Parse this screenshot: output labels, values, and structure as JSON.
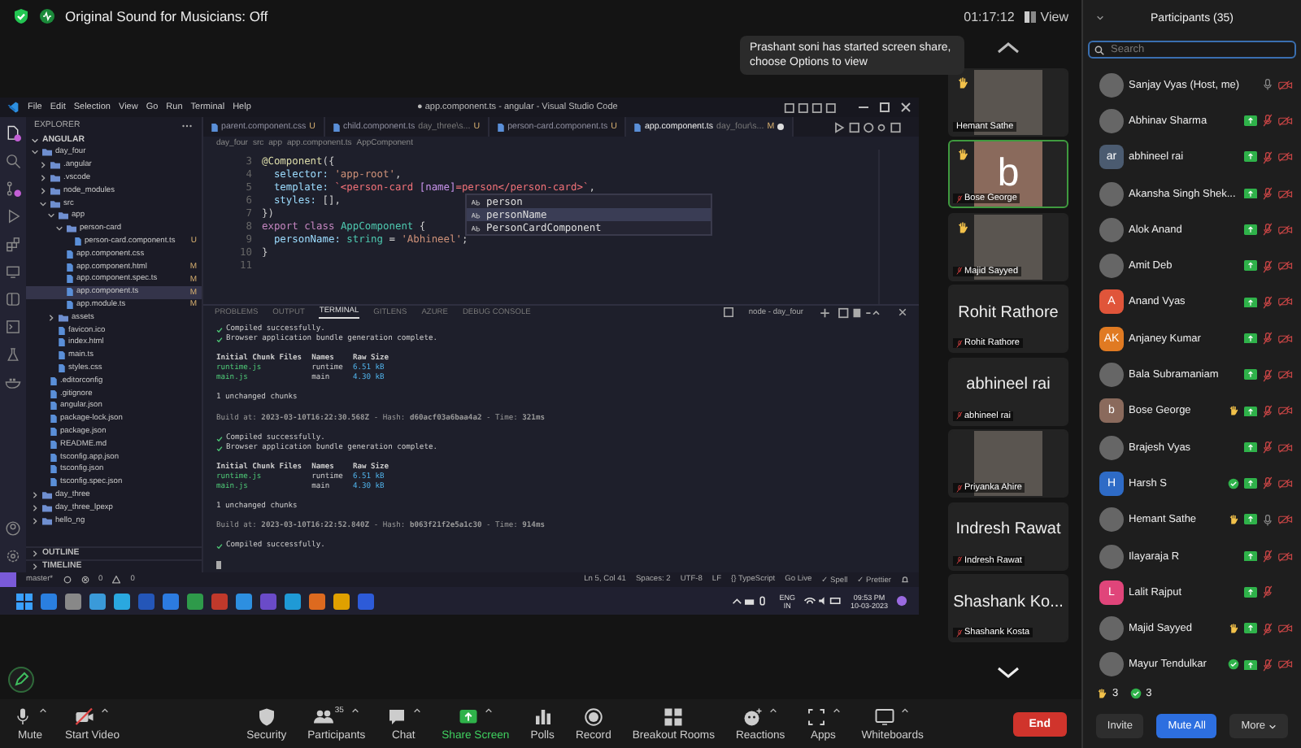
{
  "top_bar": {
    "audio_status": "Original Sound for Musicians: Off",
    "meeting_timer": "01:17:12",
    "view_button": "View"
  },
  "notification": "Prashant soni has started screen share, choose Options to view",
  "shared_screen": {
    "title": "● app.component.ts - angular - Visual Studio Code",
    "menu": [
      "File",
      "Edit",
      "Selection",
      "View",
      "Go",
      "Run",
      "Terminal",
      "Help"
    ],
    "explorer": {
      "title": "EXPLORER",
      "root": "ANGULAR",
      "tree": [
        {
          "label": "day_four",
          "kind": "folder",
          "expanded": true,
          "selected": false,
          "children": [
            {
              "label": ".angular",
              "kind": "folder",
              "expanded": false,
              "selected": false
            },
            {
              "label": ".vscode",
              "kind": "folder",
              "expanded": false,
              "selected": false
            },
            {
              "label": "node_modules",
              "kind": "folder",
              "expanded": false,
              "selected": false
            },
            {
              "label": "src",
              "kind": "folder",
              "expanded": true,
              "selected": false,
              "children": [
                {
                  "label": "app",
                  "kind": "folder",
                  "expanded": true,
                  "selected": false,
                  "children": [
                    {
                      "label": "person-card",
                      "kind": "folder",
                      "expanded": true,
                      "selected": false,
                      "children": [
                        {
                          "label": "person-card.component.ts",
                          "kind": "file",
                          "selected": false,
                          "badge": "U"
                        }
                      ]
                    },
                    {
                      "label": "app.component.css",
                      "kind": "file",
                      "selected": false
                    },
                    {
                      "label": "app.component.html",
                      "kind": "file",
                      "selected": false,
                      "badge": "M"
                    },
                    {
                      "label": "app.component.spec.ts",
                      "kind": "file",
                      "selected": false,
                      "badge": "M"
                    },
                    {
                      "label": "app.component.ts",
                      "kind": "file",
                      "selected": true,
                      "badge": "M"
                    },
                    {
                      "label": "app.module.ts",
                      "kind": "file",
                      "selected": false,
                      "badge": "M"
                    }
                  ]
                },
                {
                  "label": "assets",
                  "kind": "folder",
                  "expanded": false,
                  "selected": false
                },
                {
                  "label": "favicon.ico",
                  "kind": "file",
                  "selected": false
                },
                {
                  "label": "index.html",
                  "kind": "file",
                  "selected": false
                },
                {
                  "label": "main.ts",
                  "kind": "file",
                  "selected": false
                },
                {
                  "label": "styles.css",
                  "kind": "file",
                  "selected": false
                }
              ]
            },
            {
              "label": ".editorconfig",
              "kind": "file",
              "selected": false
            },
            {
              "label": ".gitignore",
              "kind": "file",
              "selected": false
            },
            {
              "label": "angular.json",
              "kind": "file",
              "selected": false
            },
            {
              "label": "package-lock.json",
              "kind": "file",
              "selected": false
            },
            {
              "label": "package.json",
              "kind": "file",
              "selected": false
            },
            {
              "label": "README.md",
              "kind": "file",
              "selected": false
            },
            {
              "label": "tsconfig.app.json",
              "kind": "file",
              "selected": false
            },
            {
              "label": "tsconfig.json",
              "kind": "file",
              "selected": false
            },
            {
              "label": "tsconfig.spec.json",
              "kind": "file",
              "selected": false
            }
          ]
        },
        {
          "label": "day_three",
          "kind": "folder",
          "expanded": false,
          "selected": false
        },
        {
          "label": "day_three_lpexp",
          "kind": "folder",
          "expanded": false,
          "selected": false
        },
        {
          "label": "hello_ng",
          "kind": "folder",
          "expanded": false,
          "selected": false
        }
      ],
      "sections": [
        "OUTLINE",
        "TIMELINE"
      ]
    },
    "tabs": [
      {
        "label": "parent.component.css",
        "badge": "U",
        "selected": false,
        "dirty": false
      },
      {
        "label": "child.component.ts",
        "detail": "day_three\\s...",
        "badge": "U",
        "selected": false,
        "dirty": false
      },
      {
        "label": "person-card.component.ts",
        "badge": "U",
        "selected": false,
        "dirty": false
      },
      {
        "label": "app.component.ts",
        "detail": "day_four\\s...",
        "badge": "M",
        "selected": true,
        "dirty": true
      }
    ],
    "breadcrumb": [
      "day_four",
      "src",
      "app",
      "app.component.ts",
      "AppComponent"
    ],
    "code": [
      {
        "number": "3",
        "segments": [
          {
            "t": "@Component",
            "color": "#dcdcaa"
          },
          {
            "t": "({"
          }
        ]
      },
      {
        "number": "4",
        "segments": [
          {
            "t": "  selector: ",
            "color": "#9cdcfe"
          },
          {
            "t": "'app-root'",
            "color": "#ce9178"
          },
          {
            "t": ","
          }
        ]
      },
      {
        "number": "5",
        "segments": [
          {
            "t": "  template: ",
            "color": "#9cdcfe"
          },
          {
            "t": "`<person-card",
            "color": "#f07178"
          },
          {
            "t": " [name]",
            "color": "#c792ea"
          },
          {
            "t": "=person",
            "color": "#f07178"
          },
          {
            "t": "</person-card>`",
            "color": "#f07178"
          },
          {
            "t": ","
          }
        ]
      },
      {
        "number": "6",
        "segments": [
          {
            "t": "  styles: ",
            "color": "#9cdcfe"
          },
          {
            "t": "[],"
          }
        ]
      },
      {
        "number": "7",
        "segments": [
          {
            "t": "})"
          }
        ]
      },
      {
        "number": "8",
        "segments": [
          {
            "t": "export class ",
            "color": "#c586c0"
          },
          {
            "t": "AppComponent",
            "color": "#4ec9b0"
          },
          {
            "t": " {"
          }
        ]
      },
      {
        "number": "9",
        "segments": [
          {
            "t": "  personName: ",
            "color": "#9cdcfe"
          },
          {
            "t": "string",
            "color": "#4ec9b0"
          },
          {
            "t": " = "
          },
          {
            "t": "'Abhineel'",
            "color": "#ce9178"
          },
          {
            "t": ";"
          }
        ]
      },
      {
        "number": "10",
        "segments": [
          {
            "t": "}"
          }
        ]
      },
      {
        "number": "11"
      }
    ],
    "suggestions": [
      {
        "label": "person",
        "selected": false
      },
      {
        "label": "personName",
        "selected": true
      },
      {
        "label": "PersonCardComponent",
        "selected": false
      }
    ],
    "panel_tabs": [
      {
        "label": "PROBLEMS",
        "selected": false
      },
      {
        "label": "OUTPUT",
        "selected": false
      },
      {
        "label": "TERMINAL",
        "selected": true
      },
      {
        "label": "GITLENS",
        "selected": false
      },
      {
        "label": "AZURE",
        "selected": false
      },
      {
        "label": "DEBUG CONSOLE",
        "selected": false
      }
    ],
    "terminal_name": "node - day_four",
    "terminal": [
      {
        "kind": "success",
        "lines": [
          "Compiled successfully.",
          "Browser application bundle generation complete."
        ]
      },
      {
        "kind": "table",
        "header": [
          "Initial Chunk Files",
          "Names",
          "Raw Size"
        ],
        "rows": [
          [
            "runtime.js",
            "runtime",
            "6.51 kB"
          ],
          [
            "main.js",
            "main",
            "4.30 kB"
          ]
        ]
      },
      {
        "kind": "plain",
        "lines": [
          "1 unchanged chunks"
        ]
      },
      {
        "kind": "build",
        "lines": [
          "Build at: **2023-03-10T16:22:30.568Z** - Hash: **d60acf03a6baa4a2** - Time: **321ms**"
        ]
      },
      {
        "kind": "success",
        "lines": [
          "Compiled successfully.",
          "Browser application bundle generation complete."
        ]
      },
      {
        "kind": "table",
        "header": [
          "Initial Chunk Files",
          "Names",
          "Raw Size"
        ],
        "rows": [
          [
            "runtime.js",
            "runtime",
            "6.51 kB"
          ],
          [
            "main.js",
            "main",
            "4.30 kB"
          ]
        ]
      },
      {
        "kind": "plain",
        "lines": [
          "1 unchanged chunks"
        ]
      },
      {
        "kind": "build",
        "lines": [
          "Build at: **2023-03-10T16:22:52.840Z** - Hash: **b063f21f2e5a1c30** - Time: **914ms**"
        ]
      },
      {
        "kind": "success",
        "lines": [
          "Compiled successfully."
        ]
      }
    ],
    "status_bar": {
      "branch": "master*",
      "errors": "0",
      "warnings": "0",
      "items": [
        "Ln 5, Col 41",
        "Spaces: 2",
        "UTF-8",
        "LF",
        "{} TypeScript",
        "Go Live",
        "✓ Spell",
        "✓ Prettier"
      ]
    },
    "taskbar": {
      "language": "ENG",
      "region": "IN",
      "time": "09:53 PM",
      "date": "10-03-2023"
    }
  },
  "gallery": [
    {
      "name": "Hemant Sathe",
      "kind": "video",
      "hand": true,
      "muted": false,
      "active": false
    },
    {
      "name": "Bose George",
      "kind": "avatar",
      "initial": "b",
      "color": "#8a6a5c",
      "hand": true,
      "muted": true,
      "active": true
    },
    {
      "name": "Majid Sayyed",
      "kind": "video",
      "hand": true,
      "muted": true,
      "active": false
    },
    {
      "name": "Rohit Rathore",
      "kind": "name",
      "display": "Rohit Rathore",
      "hand": false,
      "muted": true,
      "active": false
    },
    {
      "name": "abhineel rai",
      "kind": "name",
      "display": "abhineel rai",
      "hand": false,
      "muted": true,
      "active": false
    },
    {
      "name": "Priyanka Ahire",
      "kind": "video",
      "hand": false,
      "muted": true,
      "active": false
    },
    {
      "name": "Indresh Rawat",
      "kind": "name",
      "display": "Indresh Rawat",
      "hand": false,
      "muted": true,
      "active": false
    },
    {
      "name": "Shashank Kosta",
      "kind": "name",
      "display": "Shashank Ko...",
      "hand": false,
      "muted": true,
      "active": false
    }
  ],
  "participants": {
    "title": "Participants (35)",
    "search_placeholder": "Search",
    "list": [
      {
        "name": "Sanjay Vyas (Host, me)",
        "hand": false,
        "approved": false,
        "screen_icon": false,
        "muted": false,
        "camera_off": true
      },
      {
        "name": "Abhinav Sharma",
        "hand": false,
        "approved": false,
        "screen_icon": true,
        "muted": true,
        "camera_off": true
      },
      {
        "name": "abhineel rai",
        "initials": "ar",
        "color": "#4b5b70",
        "hand": false,
        "approved": false,
        "screen_icon": true,
        "muted": true,
        "camera_off": true
      },
      {
        "name": "Akansha Singh Shek...",
        "hand": false,
        "approved": false,
        "screen_icon": true,
        "muted": true,
        "camera_off": true
      },
      {
        "name": "Alok Anand",
        "hand": false,
        "approved": false,
        "screen_icon": true,
        "muted": true,
        "camera_off": true
      },
      {
        "name": "Amit Deb",
        "hand": false,
        "approved": false,
        "screen_icon": true,
        "muted": true,
        "camera_off": true
      },
      {
        "name": "Anand Vyas",
        "initials": "A",
        "color": "#e0553a",
        "hand": false,
        "approved": false,
        "screen_icon": true,
        "muted": true,
        "camera_off": true
      },
      {
        "name": "Anjaney Kumar",
        "initials": "AK",
        "color": "#e07a22",
        "hand": false,
        "approved": false,
        "screen_icon": true,
        "muted": true,
        "camera_off": true
      },
      {
        "name": "Bala Subramaniam",
        "hand": false,
        "approved": false,
        "screen_icon": true,
        "muted": true,
        "camera_off": true
      },
      {
        "name": "Bose George",
        "initials": "b",
        "color": "#8a6a5c",
        "hand": true,
        "approved": false,
        "screen_icon": true,
        "muted": true,
        "camera_off": true
      },
      {
        "name": "Brajesh Vyas",
        "hand": false,
        "approved": false,
        "screen_icon": true,
        "muted": true,
        "camera_off": true
      },
      {
        "name": "Harsh S",
        "initials": "H",
        "color": "#2e6bc6",
        "hand": false,
        "approved": true,
        "screen_icon": true,
        "muted": true,
        "camera_off": true
      },
      {
        "name": "Hemant Sathe",
        "hand": true,
        "approved": false,
        "screen_icon": true,
        "muted": false,
        "camera_off": true
      },
      {
        "name": "Ilayaraja R",
        "hand": false,
        "approved": false,
        "screen_icon": true,
        "muted": true,
        "camera_off": true
      },
      {
        "name": "Lalit Rajput",
        "initials": "L",
        "color": "#e0457a",
        "hand": false,
        "approved": false,
        "screen_icon": true,
        "muted": true,
        "camera_off": false
      },
      {
        "name": "Majid Sayyed",
        "hand": true,
        "approved": false,
        "screen_icon": true,
        "muted": true,
        "camera_off": true
      },
      {
        "name": "Mayur Tendulkar",
        "hand": false,
        "approved": true,
        "screen_icon": true,
        "muted": true,
        "camera_off": true
      }
    ],
    "raised_hands": "3",
    "approvals": "3",
    "buttons": [
      {
        "label": "Invite",
        "primary": false,
        "dropdown": false
      },
      {
        "label": "Mute All",
        "primary": true,
        "dropdown": false
      },
      {
        "label": "More",
        "primary": false,
        "dropdown": true
      }
    ]
  },
  "toolbar": {
    "items": [
      {
        "label": "Mute",
        "kind": "mic",
        "caret": true,
        "active": false
      },
      {
        "label": "Start Video",
        "kind": "video_off",
        "caret": true,
        "active": false
      },
      {
        "label": "Security",
        "kind": "shield",
        "caret": false,
        "active": false
      },
      {
        "label": "Participants",
        "kind": "people",
        "caret": true,
        "active": false,
        "badge": "35"
      },
      {
        "label": "Chat",
        "kind": "chat",
        "caret": true,
        "active": false
      },
      {
        "label": "Share Screen",
        "kind": "share",
        "caret": true,
        "active": true
      },
      {
        "label": "Polls",
        "kind": "polls",
        "caret": false,
        "active": false
      },
      {
        "label": "Record",
        "kind": "record",
        "caret": false,
        "active": false
      },
      {
        "label": "Breakout Rooms",
        "kind": "breakout",
        "caret": false,
        "active": false
      },
      {
        "label": "Reactions",
        "kind": "reactions",
        "caret": true,
        "active": false
      },
      {
        "label": "Apps",
        "kind": "apps",
        "caret": true,
        "active": false
      },
      {
        "label": "Whiteboards",
        "kind": "whiteboard",
        "caret": true,
        "active": false
      }
    ],
    "end_button": "End"
  }
}
